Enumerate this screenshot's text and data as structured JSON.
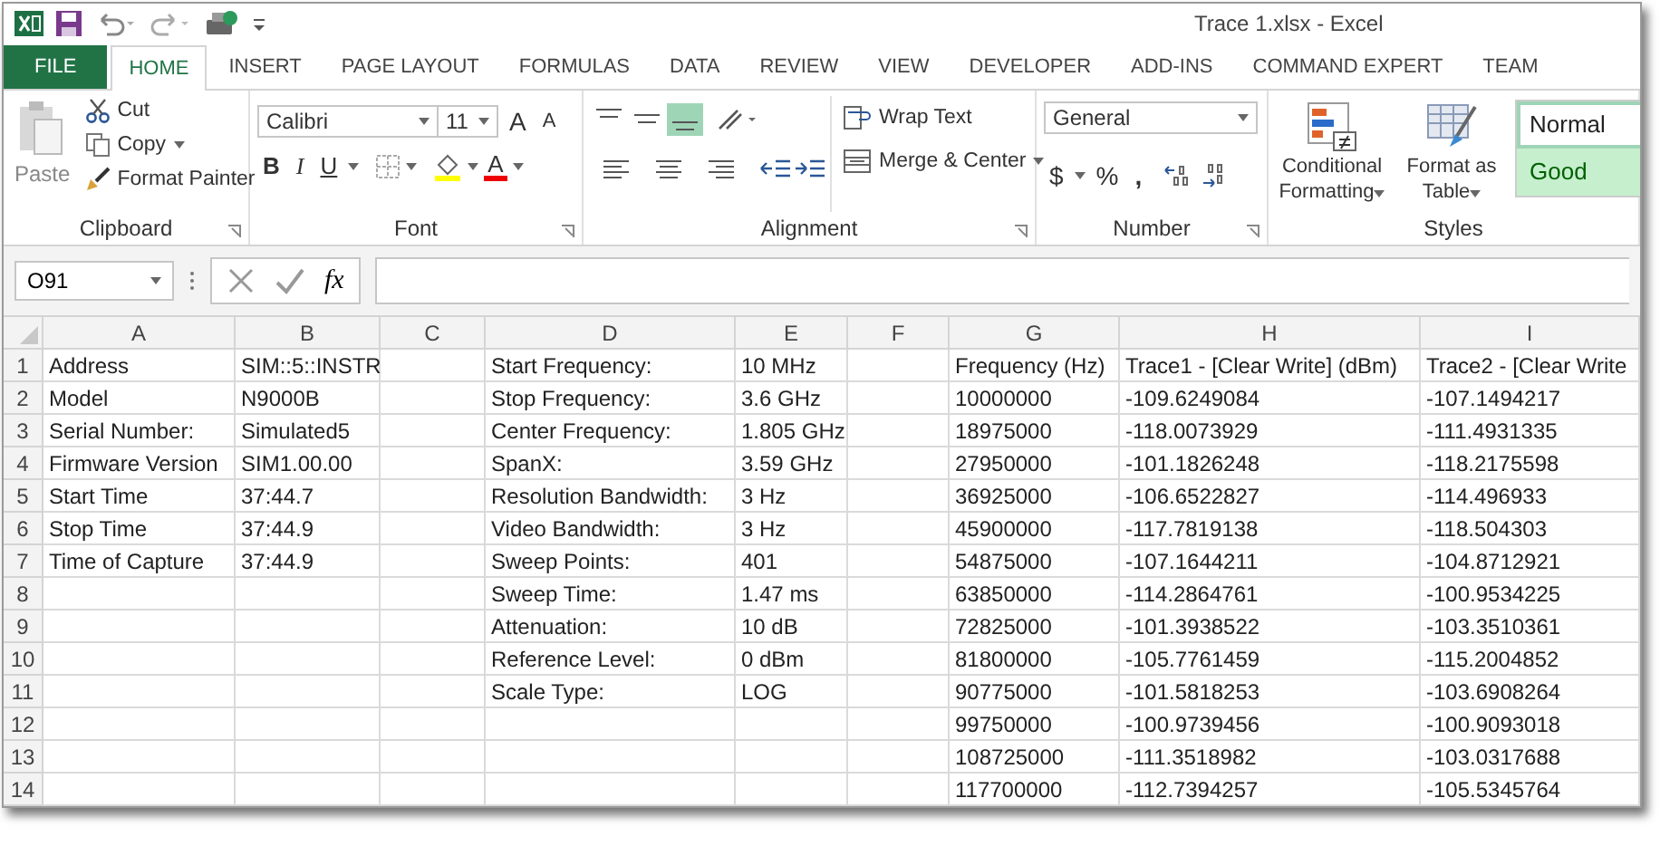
{
  "window": {
    "title": "Trace 1.xlsx - Excel"
  },
  "tabs": [
    {
      "label": "FILE",
      "kind": "file",
      "selected": false
    },
    {
      "label": "HOME",
      "kind": "tab",
      "selected": true
    },
    {
      "label": "INSERT",
      "kind": "tab",
      "selected": false
    },
    {
      "label": "PAGE LAYOUT",
      "kind": "tab",
      "selected": false
    },
    {
      "label": "FORMULAS",
      "kind": "tab",
      "selected": false
    },
    {
      "label": "DATA",
      "kind": "tab",
      "selected": false
    },
    {
      "label": "REVIEW",
      "kind": "tab",
      "selected": false
    },
    {
      "label": "VIEW",
      "kind": "tab",
      "selected": false
    },
    {
      "label": "DEVELOPER",
      "kind": "tab",
      "selected": false
    },
    {
      "label": "ADD-INS",
      "kind": "tab",
      "selected": false
    },
    {
      "label": "COMMAND EXPERT",
      "kind": "tab",
      "selected": false
    },
    {
      "label": "TEAM",
      "kind": "tab",
      "selected": false
    }
  ],
  "clipboard": {
    "label": "Clipboard",
    "paste": "Paste",
    "cut": "Cut",
    "copy": "Copy",
    "format_painter": "Format Painter"
  },
  "font": {
    "label": "Font",
    "family": "Calibri",
    "size": "11",
    "grow": "A",
    "shrink": "A",
    "bold": "B",
    "italic": "I",
    "underline": "U",
    "font_color": "A"
  },
  "alignment": {
    "label": "Alignment",
    "vertical": [
      {
        "selected": false
      },
      {
        "selected": false
      },
      {
        "selected": true
      }
    ],
    "wrap_text": "Wrap Text",
    "merge_center": "Merge & Center"
  },
  "number": {
    "label": "Number",
    "format": "General",
    "currency": "$",
    "percent": "%",
    "comma": ","
  },
  "styles": {
    "label": "Styles",
    "conditional": "Conditional Formatting",
    "format_table": "Format as Table",
    "cells": [
      {
        "label": "Normal",
        "kind": "normal",
        "selected": true
      },
      {
        "label": "Good",
        "kind": "good",
        "selected": false
      }
    ]
  },
  "formula_bar": {
    "name_box": "O91",
    "function": "fx"
  },
  "sheet": {
    "columns": [
      "A",
      "B",
      "C",
      "D",
      "E",
      "F",
      "G",
      "H",
      "I"
    ],
    "rows": [
      {
        "number": "1",
        "cells": [
          "Address",
          "SIM::5::INSTR",
          "",
          "Start Frequency:",
          "10 MHz",
          "",
          "Frequency (Hz)",
          "Trace1 - [Clear Write] (dBm)",
          "Trace2 - [Clear Write"
        ]
      },
      {
        "number": "2",
        "cells": [
          "Model",
          "N9000B",
          "",
          "Stop Frequency:",
          "3.6 GHz",
          "",
          "10000000",
          "-109.6249084",
          "-107.1494217"
        ]
      },
      {
        "number": "3",
        "cells": [
          "Serial Number:",
          "Simulated5",
          "",
          "Center Frequency:",
          "1.805 GHz",
          "",
          "18975000",
          "-118.0073929",
          "-111.4931335"
        ]
      },
      {
        "number": "4",
        "cells": [
          "Firmware Version",
          "SIM1.00.00",
          "",
          "SpanX:",
          "3.59 GHz",
          "",
          "27950000",
          "-101.1826248",
          "-118.2175598"
        ]
      },
      {
        "number": "5",
        "cells": [
          "Start Time",
          "37:44.7",
          "",
          "Resolution Bandwidth:",
          "3 Hz",
          "",
          "36925000",
          "-106.6522827",
          "-114.496933"
        ]
      },
      {
        "number": "6",
        "cells": [
          "Stop Time",
          "37:44.9",
          "",
          "Video Bandwidth:",
          "3 Hz",
          "",
          "45900000",
          "-117.7819138",
          "-118.504303"
        ]
      },
      {
        "number": "7",
        "cells": [
          "Time of Capture",
          "37:44.9",
          "",
          "Sweep Points:",
          "401",
          "",
          "54875000",
          "-107.1644211",
          "-104.8712921"
        ]
      },
      {
        "number": "8",
        "cells": [
          "",
          "",
          "",
          "Sweep Time:",
          "1.47 ms",
          "",
          "63850000",
          "-114.2864761",
          "-100.9534225"
        ]
      },
      {
        "number": "9",
        "cells": [
          "",
          "",
          "",
          "Attenuation:",
          "10 dB",
          "",
          "72825000",
          "-101.3938522",
          "-103.3510361"
        ]
      },
      {
        "number": "10",
        "cells": [
          "",
          "",
          "",
          "Reference Level:",
          "0 dBm",
          "",
          "81800000",
          "-105.7761459",
          "-115.2004852"
        ]
      },
      {
        "number": "11",
        "cells": [
          "",
          "",
          "",
          "Scale Type:",
          "LOG",
          "",
          "90775000",
          "-101.5818253",
          "-103.6908264"
        ]
      },
      {
        "number": "12",
        "cells": [
          "",
          "",
          "",
          "",
          "",
          "",
          "99750000",
          "-100.9739456",
          "-100.9093018"
        ]
      },
      {
        "number": "13",
        "cells": [
          "",
          "",
          "",
          "",
          "",
          "",
          "108725000",
          "-111.3518982",
          "-103.0317688"
        ]
      },
      {
        "number": "14",
        "cells": [
          "",
          "",
          "",
          "",
          "",
          "",
          "117700000",
          "-112.7394257",
          "-105.5345764"
        ]
      }
    ]
  }
}
